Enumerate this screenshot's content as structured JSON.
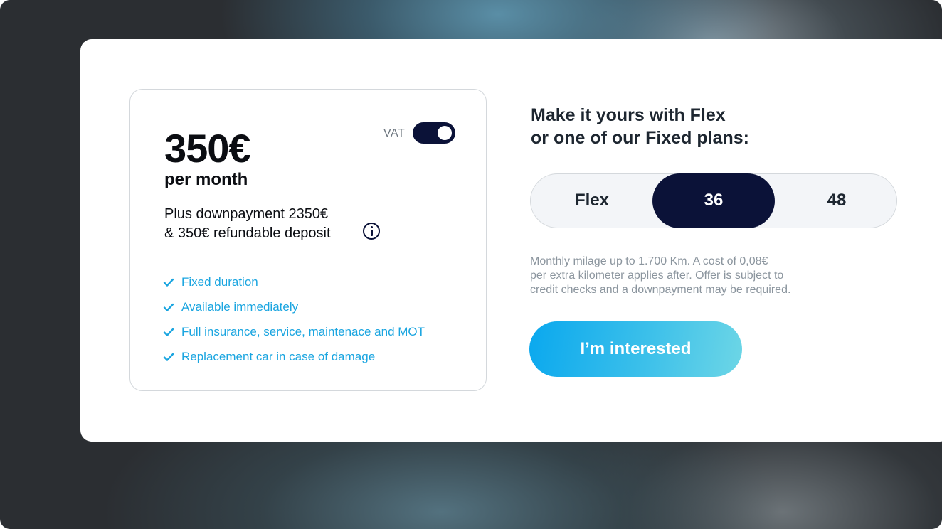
{
  "pricing": {
    "price": "350€",
    "period": "per month",
    "vat_label": "VAT",
    "vat_enabled": true,
    "downpayment_line1": "Plus downpayment 2350€",
    "downpayment_line2": "& 350€ refundable deposit",
    "features": [
      "Fixed duration",
      "Available immediately",
      "Full insurance, service, maintenace and MOT",
      "Replacement car in case of damage"
    ]
  },
  "plans": {
    "heading_line1": "Make it yours with Flex",
    "heading_line2": "or one of our Fixed plans:",
    "options": [
      "Flex",
      "36",
      "48"
    ],
    "selected": "36",
    "disclaimer_line1": "Monthly milage up to 1.700 Km. A cost of 0,08€",
    "disclaimer_line2": "per extra kilometer applies after. Offer is subject to",
    "disclaimer_line3": "credit checks and a downpayment may be required."
  },
  "cta": {
    "label": "I’m interested"
  },
  "colors": {
    "navy": "#0b1238",
    "accent_blue": "#1aa5e0",
    "cta_gradient_start": "#0aa8ee",
    "cta_gradient_end": "#6dd6e6"
  },
  "icons": {
    "info": "info-icon",
    "check": "check-icon"
  }
}
